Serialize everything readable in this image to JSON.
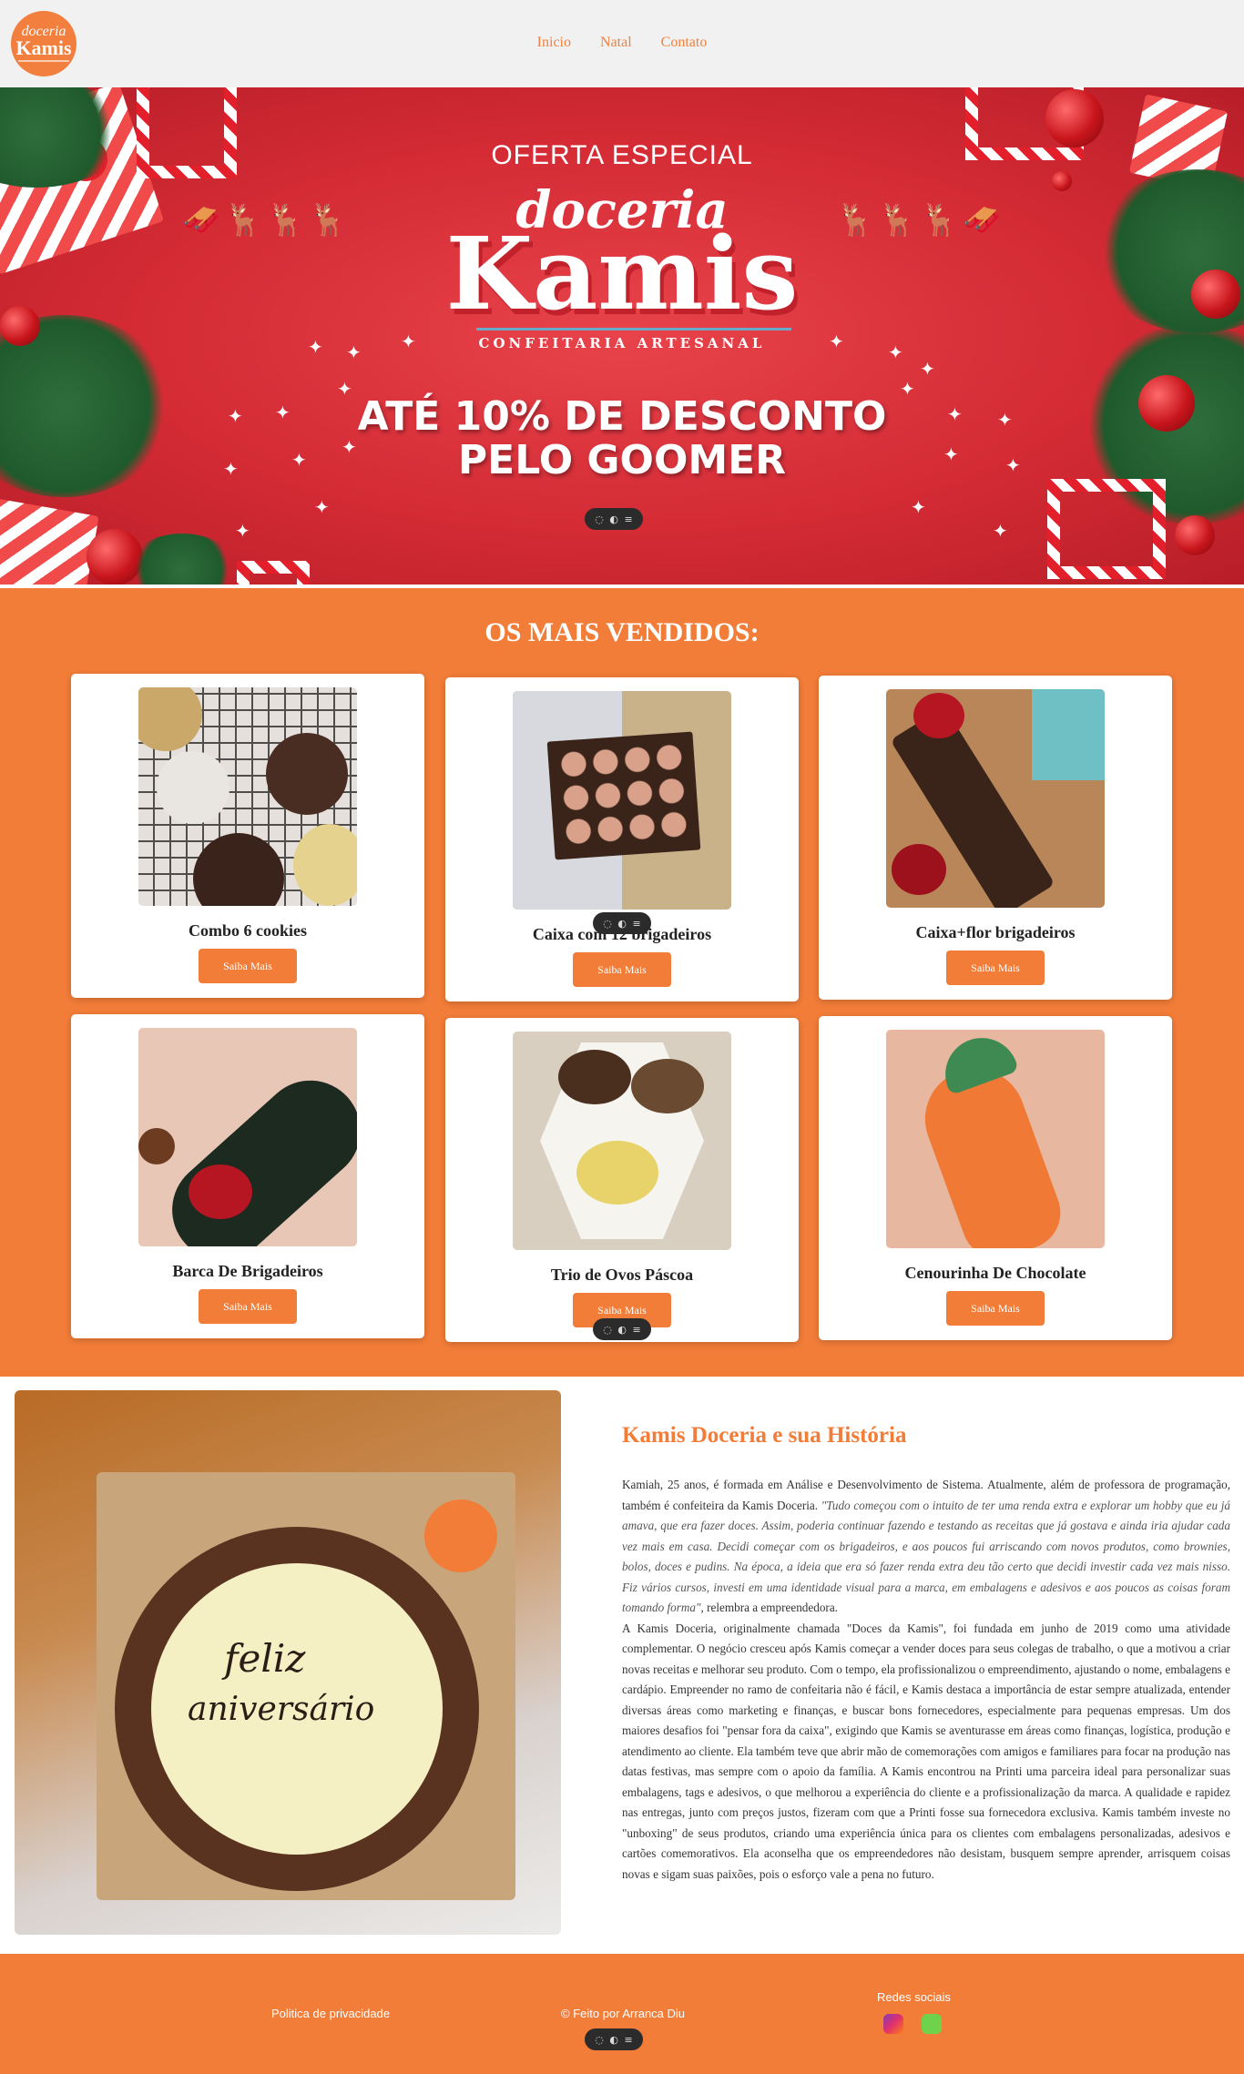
{
  "header": {
    "logo_top": "doceria",
    "logo_main": "Kamis",
    "nav": [
      "Inicio",
      "Natal",
      "Contato"
    ]
  },
  "hero": {
    "offer": "OFERTA ESPECIAL",
    "brand_script": "doceria",
    "brand_name": "Kamis",
    "tagline": "CONFEITARIA ARTESANAL",
    "discount_line1": "ATÉ 10% DE DESCONTO",
    "discount_line2": "PELO GOOMER",
    "colors": {
      "background": "#d42b35",
      "accent_line": "#6aa9c8"
    }
  },
  "toolbar_pill": {
    "icons": [
      "chat-icon",
      "toggle-icon",
      "menu-icon"
    ],
    "glyphs": [
      "◌",
      "◐",
      "≡"
    ]
  },
  "best_sellers": {
    "title": "OS MAIS VENDIDOS:",
    "button_label": "Saiba Mais",
    "items": [
      {
        "name": "Combo 6 cookies"
      },
      {
        "name": "Caixa com 12 brigadeiros"
      },
      {
        "name": "Caixa+flor brigadeiros"
      },
      {
        "name": "Barca De Brigadeiros"
      },
      {
        "name": "Trio de Ovos Páscoa"
      },
      {
        "name": "Cenourinha De Chocolate"
      }
    ],
    "colors": {
      "background": "#f27d38",
      "button": "#f27d38"
    }
  },
  "story": {
    "image_text_line1": "feliz",
    "image_text_line2": "aniversário",
    "title": "Kamis Doceria e sua História",
    "p1_intro": "Kamiah, 25 anos, é formada em Análise e Desenvolvimento de Sistema. Atualmente, além de professora de programação, também é confeiteira da Kamis Doceria. ",
    "p1_quote": "\"Tudo começou com o intuito de ter uma renda extra e explorar um hobby que eu já amava, que era fazer doces. Assim, poderia continuar fazendo e testando as receitas que já gostava e ainda iria ajudar cada vez mais em casa. Decidi começar com os brigadeiros, e aos poucos fui arriscando com novos produtos, como brownies, bolos, doces e pudins. Na época, a ideia que era só fazer renda extra deu tão certo que decidi investir cada vez mais nisso. Fiz vários cursos, investi em uma identidade visual para a marca, em embalagens e adesivos e aos poucos as coisas foram tomando forma\"",
    "p1_end": ", relembra a empreendedora.",
    "p2": "A Kamis Doceria, originalmente chamada \"Doces da Kamis\", foi fundada em junho de 2019 como uma atividade complementar. O negócio cresceu após Kamis começar a vender doces para seus colegas de trabalho, o que a motivou a criar novas receitas e melhorar seu produto. Com o tempo, ela profissionalizou o empreendimento, ajustando o nome, embalagens e cardápio. Empreender no ramo de confeitaria não é fácil, e Kamis destaca a importância de estar sempre atualizada, entender diversas áreas como marketing e finanças, e buscar bons fornecedores, especialmente para pequenas empresas. Um dos maiores desafios foi \"pensar fora da caixa\", exigindo que Kamis se aventurasse em áreas como finanças, logística, produção e atendimento ao cliente. Ela também teve que abrir mão de comemorações com amigos e familiares para focar na produção nas datas festivas, mas sempre com o apoio da família. A Kamis encontrou na Printi uma parceira ideal para personalizar suas embalagens, tags e adesivos, o que melhorou a experiência do cliente e a profissionalização da marca. A qualidade e rapidez nas entregas, junto com preços justos, fizeram com que a Printi fosse sua fornecedora exclusiva. Kamis também investe no \"unboxing\" de seus produtos, criando uma experiência única para os clientes com embalagens personalizadas, adesivos e cartões comemorativos. Ela aconselha que os empreendedores não desistam, busquem sempre aprender, arrisquem coisas novas e sigam suas paixões, pois o esforço vale a pena no futuro."
  },
  "footer": {
    "privacy": "Politica de privacidade",
    "credit": "© Feito por Arranca Diu",
    "social_title": "Redes sociais",
    "social_icons": [
      "instagram-icon",
      "whatsapp-icon"
    ]
  }
}
